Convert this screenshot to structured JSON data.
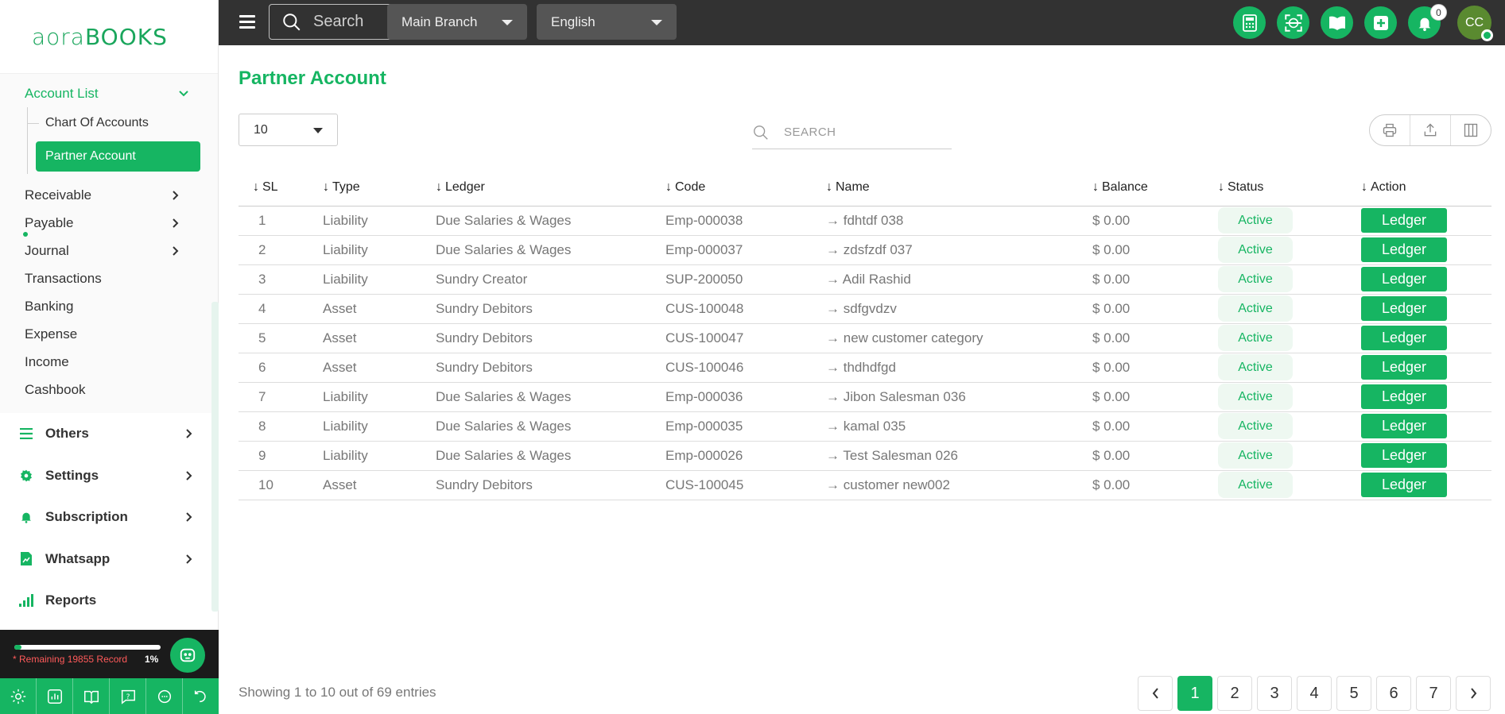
{
  "logo": {
    "part1": "aora",
    "part2": "BOOKS"
  },
  "sidebar": {
    "account_list": "Account List",
    "sub_items": [
      {
        "label": "Chart Of Accounts",
        "active": false
      },
      {
        "label": "Partner Account",
        "active": true
      }
    ],
    "items": [
      {
        "label": "Receivable",
        "has_children": true
      },
      {
        "label": "Payable",
        "has_children": true
      },
      {
        "label": "Journal",
        "has_children": true
      },
      {
        "label": "Transactions",
        "has_children": false
      },
      {
        "label": "Banking",
        "has_children": false
      },
      {
        "label": "Expense",
        "has_children": false
      },
      {
        "label": "Income",
        "has_children": false
      },
      {
        "label": "Cashbook",
        "has_children": false
      }
    ],
    "main_menu": [
      {
        "label": "Others",
        "icon": "list-icon"
      },
      {
        "label": "Settings",
        "icon": "gear-icon"
      },
      {
        "label": "Subscription",
        "icon": "bell-icon"
      },
      {
        "label": "Whatsapp",
        "icon": "document-chart-icon"
      },
      {
        "label": "Reports",
        "icon": "signal-bars-icon"
      }
    ],
    "footer": {
      "remaining": "* Remaining 19855 Record",
      "percent": "1%",
      "progress_fraction": 0.01
    }
  },
  "topbar": {
    "search_placeholder": "Search",
    "branch": "Main Branch",
    "language": "English",
    "notification_count": "0",
    "avatar_initials": "CC"
  },
  "page": {
    "title": "Partner Account",
    "page_length": "10",
    "search_placeholder": "SEARCH"
  },
  "table": {
    "headers": [
      "SL",
      "Type",
      "Ledger",
      "Code",
      "Name",
      "Balance",
      "Status",
      "Action"
    ],
    "rows": [
      {
        "sl": "1",
        "type": "Liability",
        "ledger": "Due Salaries & Wages",
        "code": "Emp-000038",
        "name": "fdhtdf 038",
        "balance": "$ 0.00",
        "status": "Active",
        "action": "Ledger"
      },
      {
        "sl": "2",
        "type": "Liability",
        "ledger": "Due Salaries & Wages",
        "code": "Emp-000037",
        "name": "zdsfzdf 037",
        "balance": "$ 0.00",
        "status": "Active",
        "action": "Ledger"
      },
      {
        "sl": "3",
        "type": "Liability",
        "ledger": "Sundry Creator",
        "code": "SUP-200050",
        "name": "Adil Rashid",
        "balance": "$ 0.00",
        "status": "Active",
        "action": "Ledger"
      },
      {
        "sl": "4",
        "type": "Asset",
        "ledger": "Sundry Debitors",
        "code": "CUS-100048",
        "name": "sdfgvdzv",
        "balance": "$ 0.00",
        "status": "Active",
        "action": "Ledger"
      },
      {
        "sl": "5",
        "type": "Asset",
        "ledger": "Sundry Debitors",
        "code": "CUS-100047",
        "name": "new customer category",
        "balance": "$ 0.00",
        "status": "Active",
        "action": "Ledger"
      },
      {
        "sl": "6",
        "type": "Asset",
        "ledger": "Sundry Debitors",
        "code": "CUS-100046",
        "name": "thdhdfgd",
        "balance": "$ 0.00",
        "status": "Active",
        "action": "Ledger"
      },
      {
        "sl": "7",
        "type": "Liability",
        "ledger": "Due Salaries & Wages",
        "code": "Emp-000036",
        "name": "Jibon Salesman 036",
        "balance": "$ 0.00",
        "status": "Active",
        "action": "Ledger"
      },
      {
        "sl": "8",
        "type": "Liability",
        "ledger": "Due Salaries & Wages",
        "code": "Emp-000035",
        "name": "kamal 035",
        "balance": "$ 0.00",
        "status": "Active",
        "action": "Ledger"
      },
      {
        "sl": "9",
        "type": "Liability",
        "ledger": "Due Salaries & Wages",
        "code": "Emp-000026",
        "name": "Test Salesman 026",
        "balance": "$ 0.00",
        "status": "Active",
        "action": "Ledger"
      },
      {
        "sl": "10",
        "type": "Asset",
        "ledger": "Sundry Debitors",
        "code": "CUS-100045",
        "name": "customer new002",
        "balance": "$ 0.00",
        "status": "Active",
        "action": "Ledger"
      }
    ]
  },
  "footer": {
    "showing": "Showing 1 to 10 out of 69 entries",
    "pages": [
      "1",
      "2",
      "3",
      "4",
      "5",
      "6",
      "7"
    ],
    "current_page": "1"
  },
  "colors": {
    "accent": "#16b562",
    "topbar": "#323232",
    "sidebar_footer": "#1b1b1b"
  }
}
